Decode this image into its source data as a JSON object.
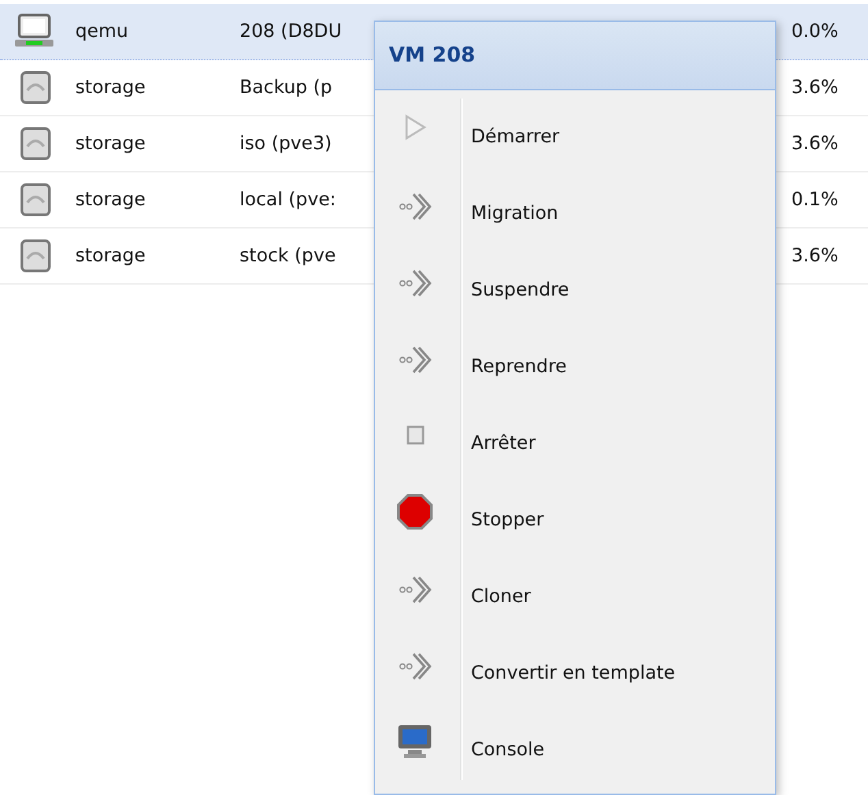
{
  "grid": {
    "rows": [
      {
        "kind": "vm",
        "type": "qemu",
        "name": "208 (D8DU",
        "usage": "0.0%",
        "selected": true
      },
      {
        "kind": "storage",
        "type": "storage",
        "name": "Backup (p",
        "usage": "3.6%",
        "selected": false
      },
      {
        "kind": "storage",
        "type": "storage",
        "name": "iso (pve3)",
        "usage": "3.6%",
        "selected": false
      },
      {
        "kind": "storage",
        "type": "storage",
        "name": "local (pve:",
        "usage": "0.1%",
        "selected": false
      },
      {
        "kind": "storage",
        "type": "storage",
        "name": "stock (pve",
        "usage": "3.6%",
        "selected": false
      }
    ]
  },
  "context_menu": {
    "title": "VM 208",
    "items": [
      {
        "kind": "play",
        "label": "Démarrer"
      },
      {
        "kind": "action",
        "label": "Migration"
      },
      {
        "kind": "action",
        "label": "Suspendre"
      },
      {
        "kind": "action",
        "label": "Reprendre"
      },
      {
        "kind": "square",
        "label": "Arrêter"
      },
      {
        "kind": "stop",
        "label": "Stopper"
      },
      {
        "kind": "action",
        "label": "Cloner"
      },
      {
        "kind": "action",
        "label": "Convertir en template"
      },
      {
        "kind": "console",
        "label": "Console"
      }
    ]
  }
}
